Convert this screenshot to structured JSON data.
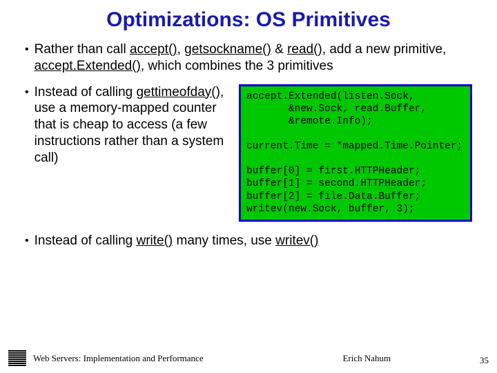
{
  "title": "Optimizations: OS Primitives",
  "bullets": {
    "b1_pre": "Rather than call ",
    "b1_u1": "accept()",
    "b1_mid1": ", ",
    "b1_u2": "getsockname()",
    "b1_mid2": " & ",
    "b1_u3": "read()",
    "b1_mid3": ", add a new primitive, ",
    "b1_u4": "accept.Extended()",
    "b1_post": ", which combines the 3 primitives",
    "b2_pre": "Instead of calling ",
    "b2_u1": "gettimeofday()",
    "b2_post": ", use a memory-mapped counter that is cheap to access (a few instructions rather than a system call)",
    "b3_pre": "Instead of calling ",
    "b3_u1": "write()",
    "b3_mid": " many times, use ",
    "b3_u2": "writev()"
  },
  "code": {
    "l1": "accept.Extended(listen.Sock,",
    "l2": "       &new.Sock, read.Buffer,",
    "l3": "       &remote.Info);",
    "l4": "",
    "l5": "current.Time = *mapped.Time.Pointer;",
    "l6": "",
    "l7": "buffer[0] = first.HTTPHeader;",
    "l8": "buffer[1] = second.HTTPHeader;",
    "l9": "buffer[2] = file.Data.Buffer;",
    "l10": "writev(new.Sock, buffer, 3);"
  },
  "footer": {
    "title": "Web Servers: Implementation and Performance",
    "author": "Erich Nahum",
    "page": "35"
  }
}
